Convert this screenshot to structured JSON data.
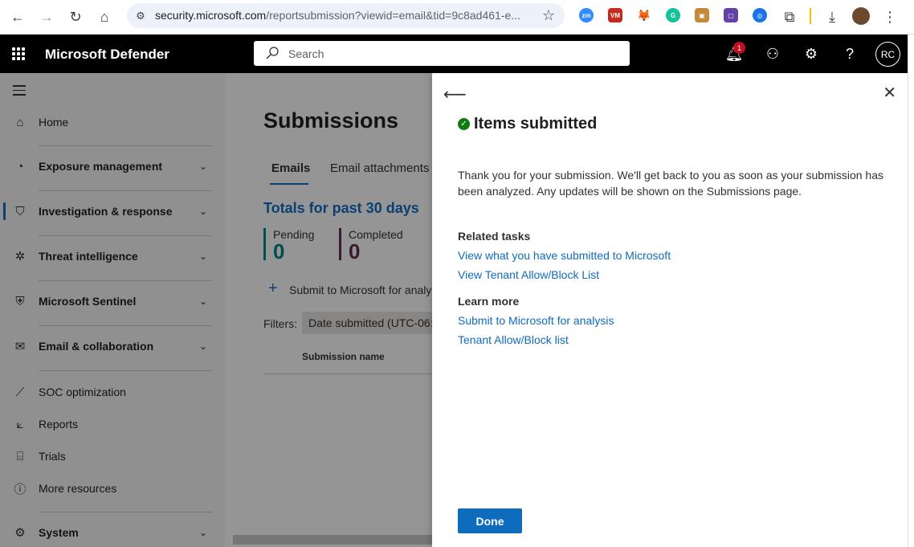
{
  "browser": {
    "url_host": "security.microsoft.com",
    "url_path": "/reportsubmission?viewid=email&tid=9c8ad461-e...",
    "extensions": [
      {
        "icon": "zoom-extension-icon",
        "label": "zm",
        "color": "#2d8cff"
      },
      {
        "icon": "vm-extension-icon",
        "label": "VM",
        "color": "#c42b1c"
      },
      {
        "icon": "metamask-fox-icon",
        "label": "🦊",
        "color": "#f6851b"
      },
      {
        "icon": "grammarly-icon",
        "label": "G",
        "color": "#15c39a"
      },
      {
        "icon": "bag-extension-icon",
        "label": "▣",
        "color": "#c48a3a"
      },
      {
        "icon": "twitch-extension-icon",
        "label": "▢",
        "color": "#6441a5"
      },
      {
        "icon": "target-extension-icon",
        "label": "◎",
        "color": "#1a73e8"
      }
    ]
  },
  "app": {
    "title": "Microsoft Defender",
    "search_placeholder": "Search",
    "notification_count": "1",
    "avatar_initials": "RC"
  },
  "sidebar": {
    "items": [
      {
        "label": "Home",
        "icon": "home-icon",
        "bold": false,
        "expandable": false
      },
      {
        "label": "Exposure management",
        "icon": "exposure-icon",
        "bold": true,
        "expandable": true
      },
      {
        "label": "Investigation & response",
        "icon": "shield-icon",
        "bold": true,
        "expandable": true
      },
      {
        "label": "Threat intelligence",
        "icon": "bug-icon",
        "bold": true,
        "expandable": true
      },
      {
        "label": "Microsoft Sentinel",
        "icon": "sentinel-icon",
        "bold": true,
        "expandable": true
      },
      {
        "label": "Email & collaboration",
        "icon": "mail-icon",
        "bold": true,
        "expandable": true
      },
      {
        "label": "SOC optimization",
        "icon": "wand-icon",
        "bold": false,
        "expandable": false
      },
      {
        "label": "Reports",
        "icon": "chart-icon",
        "bold": false,
        "expandable": false
      },
      {
        "label": "Trials",
        "icon": "gift-icon",
        "bold": false,
        "expandable": false
      },
      {
        "label": "More resources",
        "icon": "info-icon",
        "bold": false,
        "expandable": false
      },
      {
        "label": "System",
        "icon": "gear-icon",
        "bold": true,
        "expandable": true
      }
    ]
  },
  "main": {
    "title": "Submissions",
    "tabs": [
      "Emails",
      "Email attachments"
    ],
    "totals_label": "Totals for past 30 days",
    "stats": [
      {
        "label": "Pending",
        "value": "0",
        "color": "#038387"
      },
      {
        "label": "Completed",
        "value": "0",
        "color": "#5c2e51"
      }
    ],
    "submit_label": "Submit to Microsoft for analy",
    "filters_label": "Filters:",
    "filter_chip": "Date submitted (UTC-06:0",
    "column_header": "Submission name"
  },
  "panel": {
    "title": "Items submitted",
    "description": "Thank you for your submission. We'll get back to you as soon as your submission has been analyzed. Any updates will be shown on the Submissions page.",
    "related_tasks_heading": "Related tasks",
    "related_tasks": [
      "View what you have submitted to Microsoft",
      "View Tenant Allow/Block List"
    ],
    "learn_more_heading": "Learn more",
    "learn_more": [
      "Submit to Microsoft for analysis",
      "Tenant Allow/Block list"
    ],
    "done_label": "Done"
  },
  "colors": {
    "accent": "#0f6cbd",
    "success": "#107c10"
  }
}
